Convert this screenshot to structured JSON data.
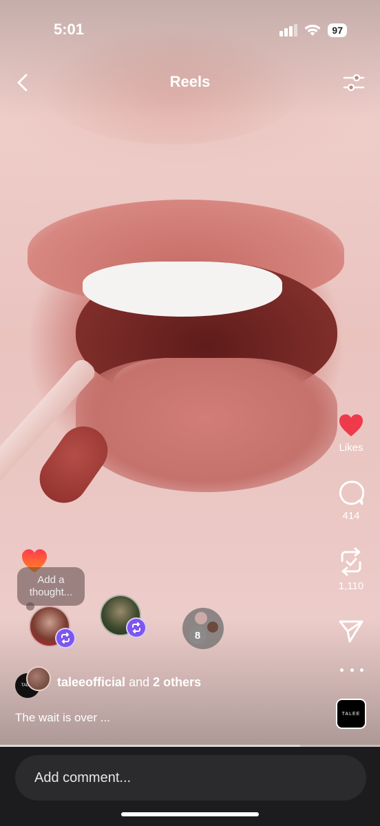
{
  "status": {
    "time": "5:01",
    "battery": "97"
  },
  "header": {
    "title": "Reels"
  },
  "rail": {
    "likes_label": "Likes",
    "comments_count": "414",
    "reposts_count": "1,110",
    "audio_thumb_text": "TALEE"
  },
  "thought": {
    "placeholder": "Add a thought..."
  },
  "repost_group": {
    "count": "8"
  },
  "author": {
    "avatar_text": "TALEE",
    "username": "taleeofficial",
    "conjunction": "and",
    "others": "2 others"
  },
  "caption": "The wait is over ...",
  "progress_fraction": 0.79,
  "comment": {
    "placeholder": "Add comment..."
  },
  "colors": {
    "like": "#ee3a4a",
    "repost_badge": "#7d55ef",
    "bottom_bar": "#1c1c1e"
  }
}
